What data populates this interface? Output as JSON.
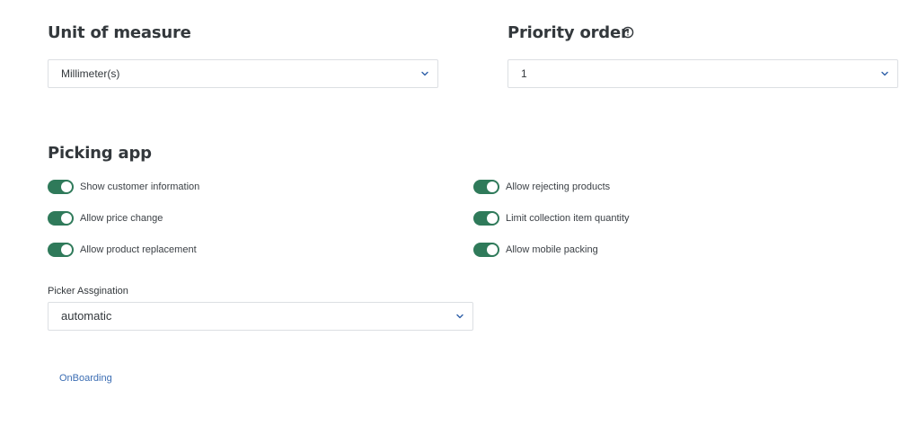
{
  "unit_of_measure": {
    "title": "Unit of measure",
    "selected": "Millimeter(s)",
    "icon": "chevron-down-icon"
  },
  "priority_order": {
    "title": "Priority order",
    "info_icon": "info-icon",
    "selected": "1",
    "icon": "chevron-down-icon"
  },
  "picking_app": {
    "title": "Picking app",
    "toggle_color": "#2f7a5a",
    "toggles_left": [
      {
        "label": "Show customer information",
        "on": true
      },
      {
        "label": "Allow price change",
        "on": true
      },
      {
        "label": "Allow product replacement",
        "on": true
      }
    ],
    "toggles_right": [
      {
        "label": "Allow rejecting products",
        "on": true
      },
      {
        "label": "Limit collection item quantity",
        "on": true
      },
      {
        "label": "Allow mobile packing",
        "on": true
      }
    ]
  },
  "picker_assignation": {
    "label": "Picker Assgination",
    "selected": "automatic",
    "icon": "chevron-down-icon"
  },
  "onboarding_link": "OnBoarding",
  "colors": {
    "accent_link": "#3b6db3",
    "chevron": "#2f5fa8",
    "toggle_on": "#2f7a5a"
  }
}
